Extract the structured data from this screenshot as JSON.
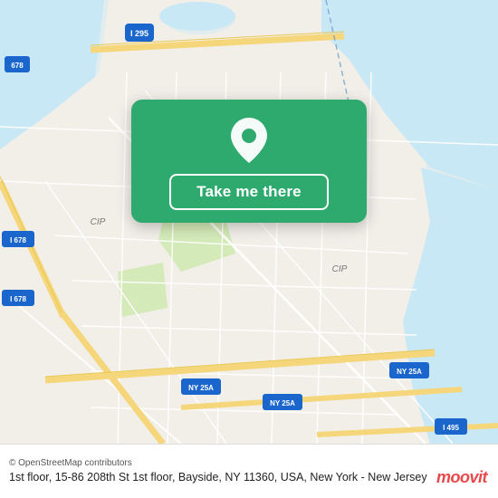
{
  "map": {
    "bg_color": "#f2efe9",
    "water_color": "#c9e8f5",
    "road_color": "#ffffff",
    "highway_color": "#f5d67a",
    "park_color": "#d4eab8"
  },
  "card": {
    "bg_color": "#2eaa6e",
    "button_label": "Take me there",
    "pin_color": "white"
  },
  "bottom": {
    "osm_credit": "© OpenStreetMap contributors",
    "address": "1st floor, 15-86 208th St 1st floor, Bayside, NY 11360, USA, New York - New Jersey",
    "logo": "moovit"
  },
  "labels": {
    "i295": "I 295",
    "i678_top": "678",
    "i678_mid": "I 678",
    "i678_bot": "I 678",
    "cip_left": "CIP",
    "cip_right": "CIP",
    "ny25a_1": "NY 25A",
    "ny25a_2": "NY 25A",
    "ny25a_3": "NY 25A",
    "i495": "I 495"
  }
}
